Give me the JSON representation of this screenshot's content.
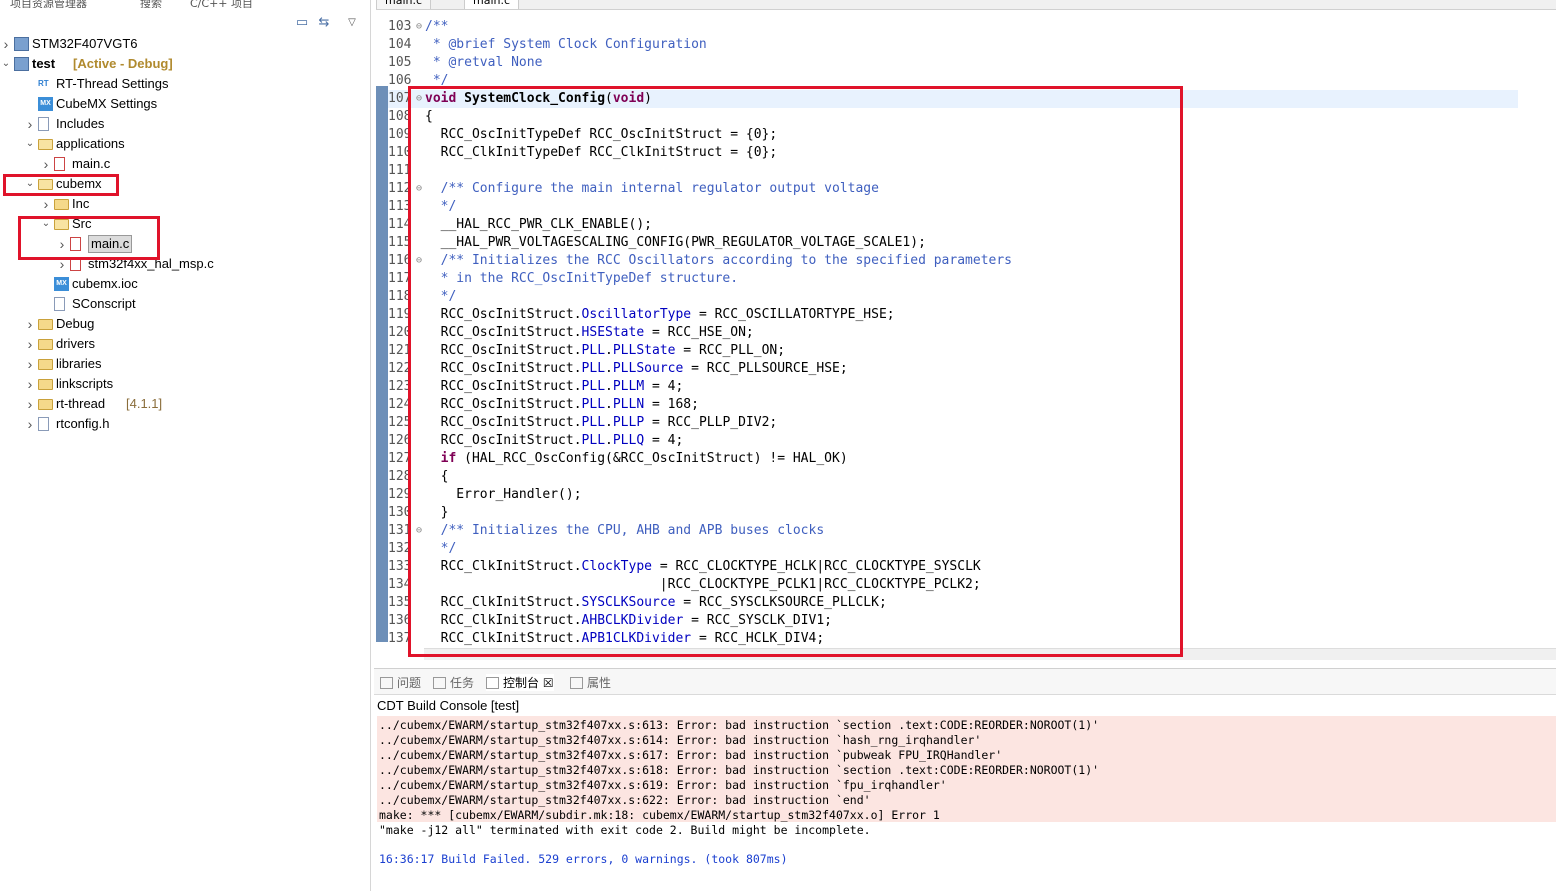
{
  "left_panel": {
    "tabs": [
      "项目资源管理器",
      "搜索",
      "C/C++ 项目"
    ],
    "tree": [
      {
        "arrow": ">",
        "icon": "project-icon",
        "label": "STM32F407VGT6",
        "suffix": ""
      },
      {
        "arrow": "v",
        "icon": "project-icon",
        "label": "test",
        "suffix": "[Active - Debug]"
      },
      {
        "arrow": "",
        "icon": "rt-thread-icon",
        "label": "RT-Thread Settings",
        "suffix": ""
      },
      {
        "arrow": "",
        "icon": "cubemx-icon",
        "label": "CubeMX Settings",
        "suffix": ""
      },
      {
        "arrow": ">",
        "icon": "includes-icon",
        "label": "Includes",
        "suffix": ""
      },
      {
        "arrow": "v",
        "icon": "folder-icon",
        "label": "applications",
        "suffix": ""
      },
      {
        "arrow": ">",
        "icon": "c-file-icon",
        "label": "main.c",
        "suffix": ""
      },
      {
        "arrow": "v",
        "icon": "folder-icon",
        "label": "cubemx",
        "suffix": ""
      },
      {
        "arrow": ">",
        "icon": "folder-icon",
        "label": "Inc",
        "suffix": ""
      },
      {
        "arrow": "v",
        "icon": "folder-icon",
        "label": "Src",
        "suffix": ""
      },
      {
        "arrow": ">",
        "icon": "c-file-icon",
        "label": "main.c",
        "suffix": ""
      },
      {
        "arrow": ">",
        "icon": "c-file-icon",
        "label": "stm32f4xx_hal_msp.c",
        "suffix": ""
      },
      {
        "arrow": "",
        "icon": "cubemx-icon",
        "label": "cubemx.ioc",
        "suffix": ""
      },
      {
        "arrow": "",
        "icon": "file-icon",
        "label": "SConscript",
        "suffix": ""
      },
      {
        "arrow": ">",
        "icon": "folder-icon",
        "label": "Debug",
        "suffix": ""
      },
      {
        "arrow": ">",
        "icon": "folder-icon",
        "label": "drivers",
        "suffix": ""
      },
      {
        "arrow": ">",
        "icon": "folder-icon",
        "label": "libraries",
        "suffix": ""
      },
      {
        "arrow": ">",
        "icon": "folder-icon",
        "label": "linkscripts",
        "suffix": ""
      },
      {
        "arrow": ">",
        "icon": "folder-icon",
        "label": "rt-thread",
        "suffix": "[4.1.1]"
      },
      {
        "arrow": ">",
        "icon": "h-file-icon",
        "label": "rtconfig.h",
        "suffix": ""
      }
    ]
  },
  "editor": {
    "tabs": [
      "main.c",
      "main.c"
    ],
    "lines": [
      {
        "n": "103",
        "text": "/**",
        "cls": "cm"
      },
      {
        "n": "104",
        "text": " * @brief System Clock Configuration",
        "cls": "cm"
      },
      {
        "n": "105",
        "text": " * @retval None",
        "cls": "cm"
      },
      {
        "n": "106",
        "text": " */",
        "cls": "cm"
      },
      {
        "n": "107",
        "text": "void SystemClock_Config(void)",
        "cls": "kwline"
      },
      {
        "n": "108",
        "text": "{",
        "cls": ""
      },
      {
        "n": "109",
        "text": "  RCC_OscInitTypeDef RCC_OscInitStruct = {0};",
        "cls": ""
      },
      {
        "n": "110",
        "text": "  RCC_ClkInitTypeDef RCC_ClkInitStruct = {0};",
        "cls": ""
      },
      {
        "n": "111",
        "text": "",
        "cls": ""
      },
      {
        "n": "112",
        "text": "  /** Configure the main internal regulator output voltage",
        "cls": "cm"
      },
      {
        "n": "113",
        "text": "  */",
        "cls": "cm"
      },
      {
        "n": "114",
        "text": "  __HAL_RCC_PWR_CLK_ENABLE();",
        "cls": ""
      },
      {
        "n": "115",
        "text": "  __HAL_PWR_VOLTAGESCALING_CONFIG(PWR_REGULATOR_VOLTAGE_SCALE1);",
        "cls": ""
      },
      {
        "n": "116",
        "text": "  /** Initializes the RCC Oscillators according to the specified parameters",
        "cls": "cm"
      },
      {
        "n": "117",
        "text": "  * in the RCC_OscInitTypeDef structure.",
        "cls": "cm"
      },
      {
        "n": "118",
        "text": "  */",
        "cls": "cm"
      },
      {
        "n": "119",
        "text": "  RCC_OscInitStruct.OscillatorType = RCC_OSCILLATORTYPE_HSE;",
        "cls": ""
      },
      {
        "n": "120",
        "text": "  RCC_OscInitStruct.HSEState = RCC_HSE_ON;",
        "cls": ""
      },
      {
        "n": "121",
        "text": "  RCC_OscInitStruct.PLL.PLLState = RCC_PLL_ON;",
        "cls": ""
      },
      {
        "n": "122",
        "text": "  RCC_OscInitStruct.PLL.PLLSource = RCC_PLLSOURCE_HSE;",
        "cls": ""
      },
      {
        "n": "123",
        "text": "  RCC_OscInitStruct.PLL.PLLM = 4;",
        "cls": ""
      },
      {
        "n": "124",
        "text": "  RCC_OscInitStruct.PLL.PLLN = 168;",
        "cls": ""
      },
      {
        "n": "125",
        "text": "  RCC_OscInitStruct.PLL.PLLP = RCC_PLLP_DIV2;",
        "cls": ""
      },
      {
        "n": "126",
        "text": "  RCC_OscInitStruct.PLL.PLLQ = 4;",
        "cls": ""
      },
      {
        "n": "127",
        "text": "  if (HAL_RCC_OscConfig(&RCC_OscInitStruct) != HAL_OK)",
        "cls": ""
      },
      {
        "n": "128",
        "text": "  {",
        "cls": ""
      },
      {
        "n": "129",
        "text": "    Error_Handler();",
        "cls": ""
      },
      {
        "n": "130",
        "text": "  }",
        "cls": ""
      },
      {
        "n": "131",
        "text": "  /** Initializes the CPU, AHB and APB buses clocks",
        "cls": "cm"
      },
      {
        "n": "132",
        "text": "  */",
        "cls": "cm"
      },
      {
        "n": "133",
        "text": "  RCC_ClkInitStruct.ClockType = RCC_CLOCKTYPE_HCLK|RCC_CLOCKTYPE_SYSCLK",
        "cls": ""
      },
      {
        "n": "134",
        "text": "                              |RCC_CLOCKTYPE_PCLK1|RCC_CLOCKTYPE_PCLK2;",
        "cls": ""
      },
      {
        "n": "135",
        "text": "  RCC_ClkInitStruct.SYSCLKSource = RCC_SYSCLKSOURCE_PLLCLK;",
        "cls": ""
      },
      {
        "n": "136",
        "text": "  RCC_ClkInitStruct.AHBCLKDivider = RCC_SYSCLK_DIV1;",
        "cls": ""
      },
      {
        "n": "137",
        "text": "  RCC_ClkInitStruct.APB1CLKDivider = RCC_HCLK_DIV4;",
        "cls": ""
      }
    ]
  },
  "console": {
    "tabs": [
      "问题",
      "任务",
      "控制台",
      "属性"
    ],
    "title": "CDT Build Console [test]",
    "lines": [
      "../cubemx/EWARM/startup_stm32f407xx.s:613: Error: bad instruction `section .text:CODE:REORDER:NOROOT(1)'",
      "../cubemx/EWARM/startup_stm32f407xx.s:614: Error: bad instruction `hash_rng_irqhandler'",
      "../cubemx/EWARM/startup_stm32f407xx.s:617: Error: bad instruction `pubweak FPU_IRQHandler'",
      "../cubemx/EWARM/startup_stm32f407xx.s:618: Error: bad instruction `section .text:CODE:REORDER:NOROOT(1)'",
      "../cubemx/EWARM/startup_stm32f407xx.s:619: Error: bad instruction `fpu_irqhandler'",
      "../cubemx/EWARM/startup_stm32f407xx.s:622: Error: bad instruction `end'",
      "make: *** [cubemx/EWARM/subdir.mk:18: cubemx/EWARM/startup_stm32f407xx.o] Error 1",
      "\"make -j12 all\" terminated with exit code 2. Build might be incomplete."
    ],
    "status": "16:36:17 Build Failed. 529 errors, 0 warnings. (took 807ms)"
  },
  "colors": {
    "highlight_box": "#e0132a",
    "comment": "#3f5fbf",
    "keyword": "#7f0055",
    "field": "#0000c0",
    "console_error_bg": "#fce5e1",
    "status_blue": "#1a3fd0"
  }
}
